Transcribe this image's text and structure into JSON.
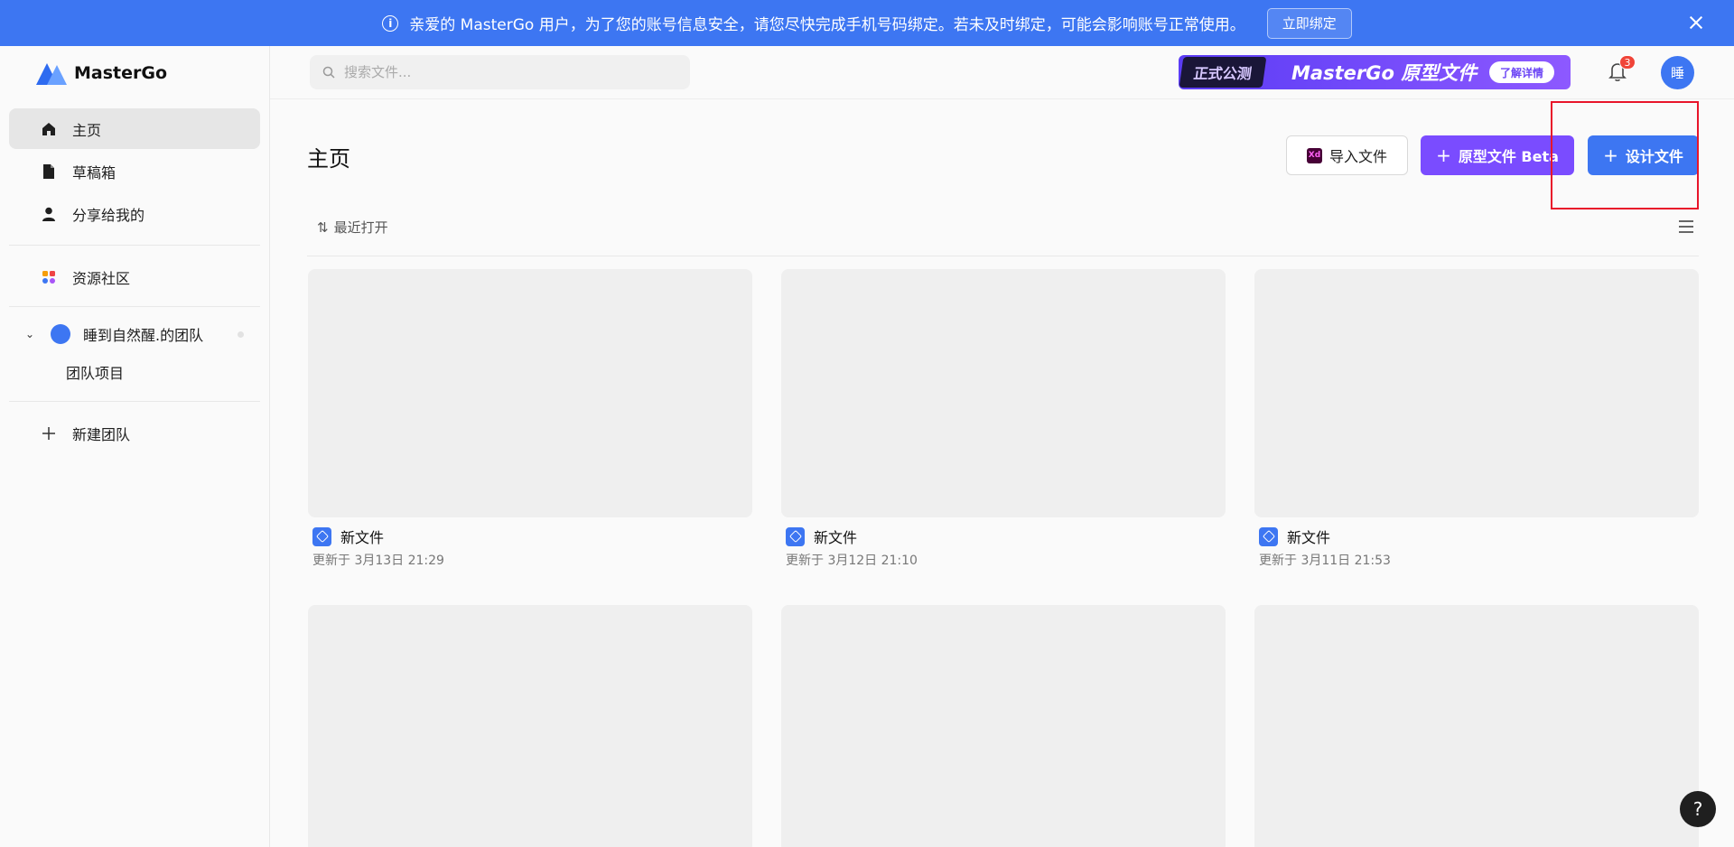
{
  "banner": {
    "message": "亲爱的 MasterGo 用户，为了您的账号信息安全，请您尽快完成手机号码绑定。若未及时绑定，可能会影响账号正常使用。",
    "bind_label": "立即绑定"
  },
  "brand": {
    "name": "MasterGo"
  },
  "sidebar": {
    "items": [
      {
        "label": "主页",
        "icon": "home-icon",
        "active": true
      },
      {
        "label": "草稿箱",
        "icon": "draft-icon",
        "active": false
      },
      {
        "label": "分享给我的",
        "icon": "user-icon",
        "active": false
      }
    ],
    "community_label": "资源社区",
    "team": {
      "name": "睡到自然醒.的团队",
      "sub_items": [
        "团队项目"
      ]
    },
    "new_team_label": "新建团队"
  },
  "header": {
    "search_placeholder": "搜索文件...",
    "promo": {
      "tag": "正式公测",
      "title": "MasterGo 原型文件",
      "more": "了解详情"
    },
    "notification_count": "3",
    "avatar_initial": "睡"
  },
  "main": {
    "title": "主页",
    "import_label": "导入文件",
    "import_icon_text": "Xd",
    "proto_label": "原型文件 Beta",
    "design_label": "设计文件",
    "sort_label": "最近打开",
    "files": [
      {
        "name": "新文件",
        "updated": "更新于 3月13日 21:29"
      },
      {
        "name": "新文件",
        "updated": "更新于 3月12日 21:10"
      },
      {
        "name": "新文件",
        "updated": "更新于 3月11日 21:53"
      }
    ]
  },
  "help": {
    "label": "?"
  },
  "colors": {
    "accent": "#3d76f2",
    "proto": "#7a4cff",
    "highlight": "#e8152a"
  }
}
